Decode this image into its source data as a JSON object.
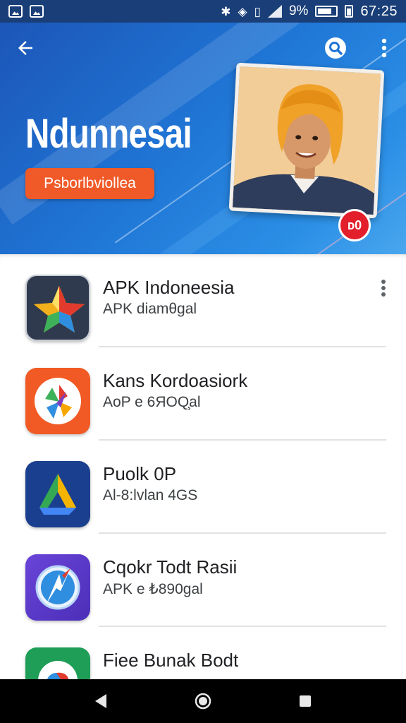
{
  "status_bar": {
    "battery_percent": "‪9%",
    "time": "67:25",
    "icons": [
      "image-icon",
      "photo-icon",
      "bluetooth-icon",
      "data-saver-icon",
      "vibrate-icon",
      "signal-icon",
      "battery-icon"
    ]
  },
  "hero": {
    "title": "Ndunnesai",
    "button_label": "Psborlbviollea",
    "badge_text": "ᴅ0",
    "carousel": {
      "pages": 4,
      "active": 0
    },
    "colors": {
      "accent": "#f05a28",
      "background": "#1f74d4"
    },
    "icons": [
      "arrow-back-icon",
      "search-icon",
      "more-vert-icon"
    ]
  },
  "apps": [
    {
      "name": "APK Indoneesia",
      "subtitle": "APK diamθgal",
      "icon": "star-app-icon",
      "icon_bg": "#2f3a4e",
      "has_menu": true
    },
    {
      "name": "Kans Kordoasiork",
      "subtitle": "AoP e 6ЯOQ̧al",
      "icon": "pinwheel-app-icon",
      "icon_bg": "#f15a24",
      "has_menu": false
    },
    {
      "name": "Puolk 0P",
      "subtitle": "Al-8:lvlan 4GS",
      "icon": "triangle-app-icon",
      "icon_bg": "#1b3f8f",
      "has_menu": false
    },
    {
      "name": "Cqokr Todt Rasii",
      "subtitle": "APK e ₺890gal",
      "icon": "compass-app-icon",
      "icon_bg": "#5b3ccc",
      "has_menu": false
    },
    {
      "name": "Fiee Bunak Bodt",
      "subtitle": "",
      "icon": "maps-app-icon",
      "icon_bg": "#1e9e57",
      "has_menu": false
    }
  ],
  "nav_bar": {
    "icons": [
      "back-nav-icon",
      "home-nav-icon",
      "recents-nav-icon"
    ]
  }
}
